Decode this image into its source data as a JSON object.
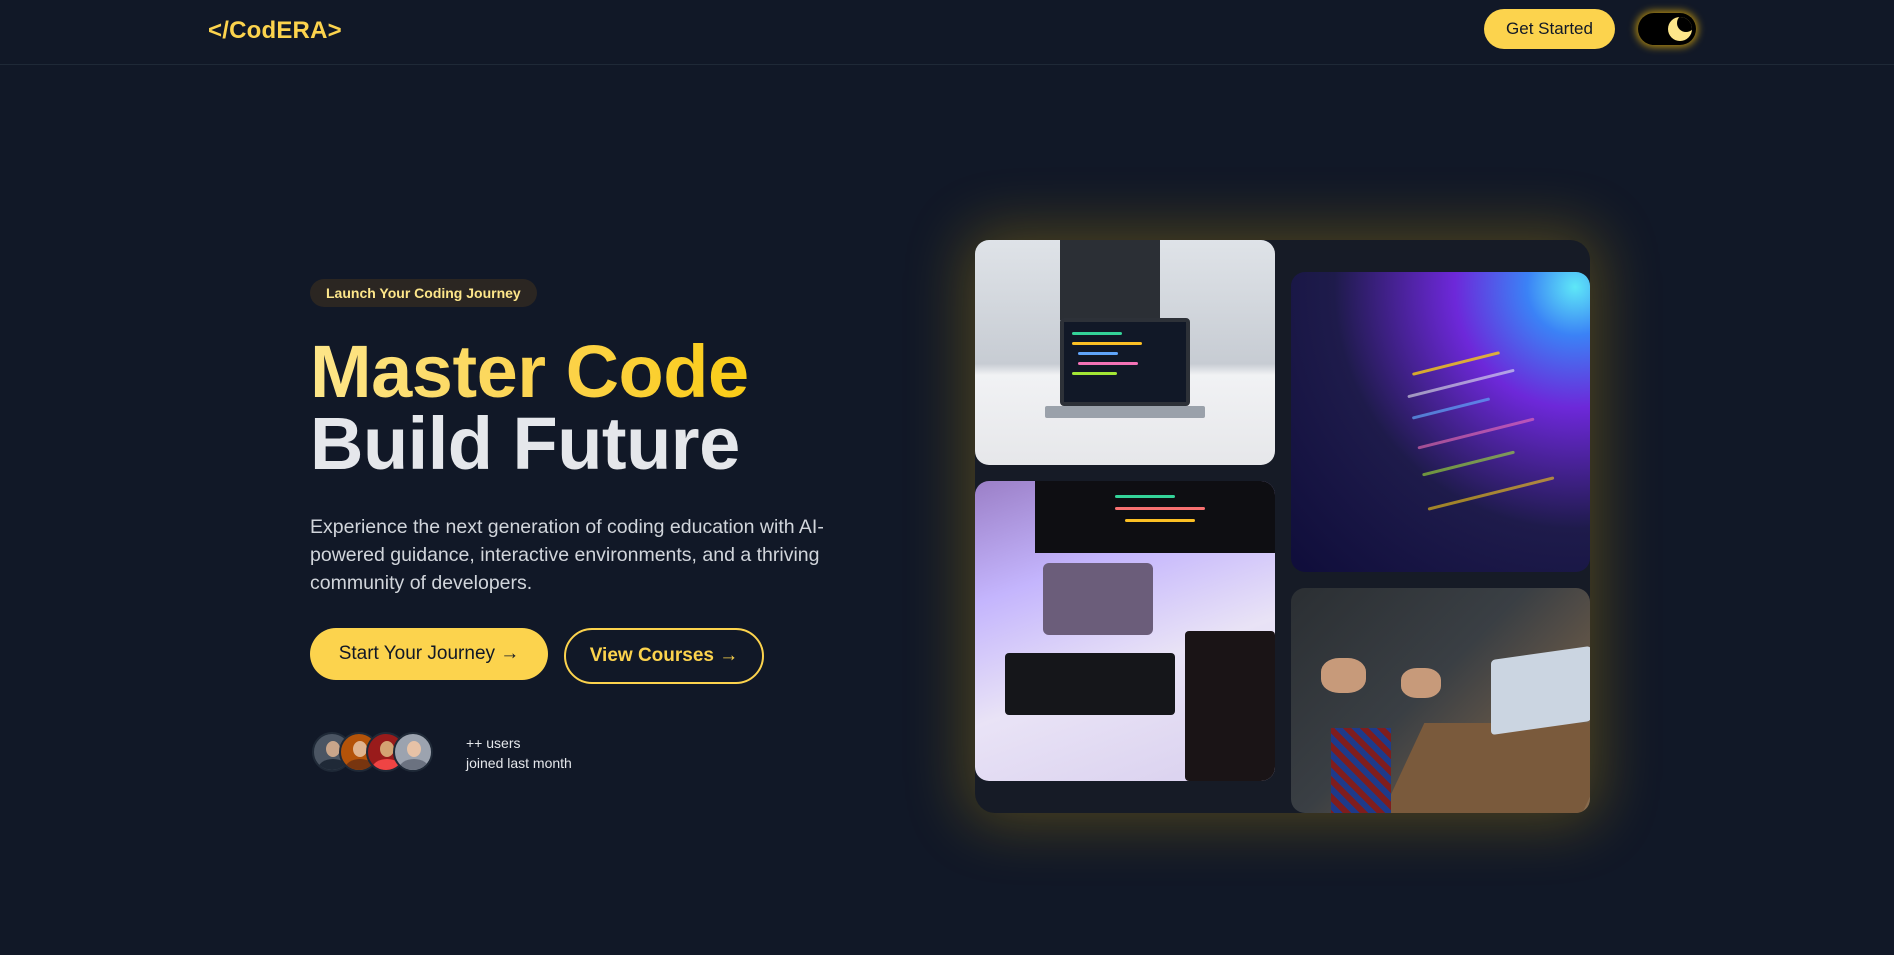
{
  "header": {
    "logo": "</CodERA>",
    "get_started_label": "Get Started",
    "theme_toggle_icon": "moon-icon"
  },
  "hero": {
    "badge": "Launch Your Coding Journey",
    "title_line1": "Master Code",
    "title_line2": "Build Future",
    "subtitle": "Experience the next generation of coding education with AI-powered guidance, interactive environments, and a thriving community of developers.",
    "primary_button": "Start Your Journey →",
    "secondary_button": "View Courses →",
    "users_count": "++ users",
    "users_caption": "joined last month"
  },
  "avatars": [
    "avatar-1",
    "avatar-2",
    "avatar-3",
    "avatar-4"
  ],
  "images": [
    {
      "name": "laptop-on-desk-photo"
    },
    {
      "name": "code-on-screen-photo"
    },
    {
      "name": "purple-desk-setup-photo"
    },
    {
      "name": "team-meeting-photo"
    }
  ],
  "colors": {
    "background": "#111827",
    "accent": "#fcd34d",
    "text": "#e5e7eb"
  }
}
